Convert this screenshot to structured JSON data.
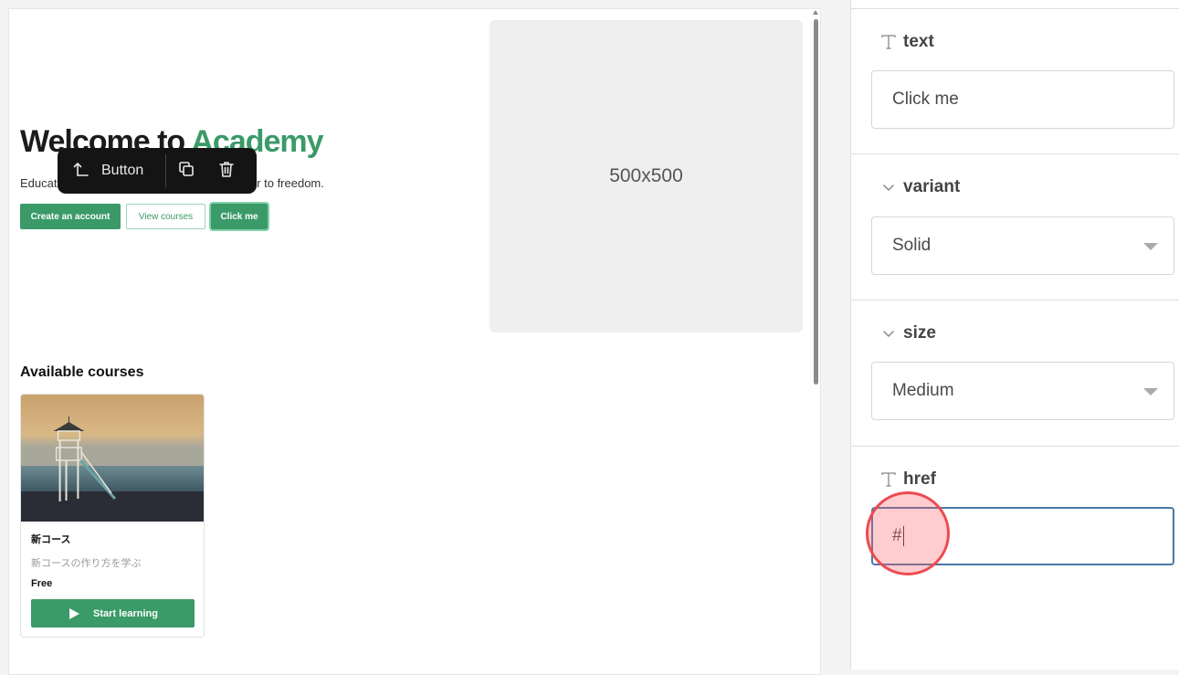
{
  "canvas": {
    "hero": {
      "title_prefix": "Welcome to ",
      "title_accent": "Academy",
      "subtitle_left": "Educat",
      "subtitle_right": "door to freedom."
    },
    "buttons": [
      {
        "label": "Create an account",
        "style": "solid"
      },
      {
        "label": "View courses",
        "style": "outline"
      },
      {
        "label": "Click me",
        "style": "solid"
      }
    ],
    "toolbar": {
      "parent_label": "Button",
      "icons": [
        "select-parent-icon",
        "duplicate-icon",
        "delete-icon"
      ]
    },
    "image_placeholder": "500x500",
    "courses_section": {
      "title": "Available courses",
      "courses": [
        {
          "name": "新コース",
          "description": "新コースの作り方を学ぶ",
          "price": "Free",
          "button_label": "Start learning"
        }
      ]
    }
  },
  "panel": {
    "properties": [
      {
        "key": "text",
        "label": "text",
        "icon": "text-type-icon",
        "value": "Click me",
        "kind": "text"
      },
      {
        "key": "variant",
        "label": "variant",
        "icon": "chevron-down-icon",
        "value": "Solid",
        "kind": "select"
      },
      {
        "key": "size",
        "label": "size",
        "icon": "chevron-down-icon",
        "value": "Medium",
        "kind": "select"
      },
      {
        "key": "href",
        "label": "href",
        "icon": "text-type-icon",
        "value": "#",
        "kind": "text"
      }
    ]
  },
  "colors": {
    "accent": "#3a9a68",
    "toolbar_bg": "#141414",
    "focus_border": "#4a77a8",
    "click_marker": "#ec4b52"
  }
}
